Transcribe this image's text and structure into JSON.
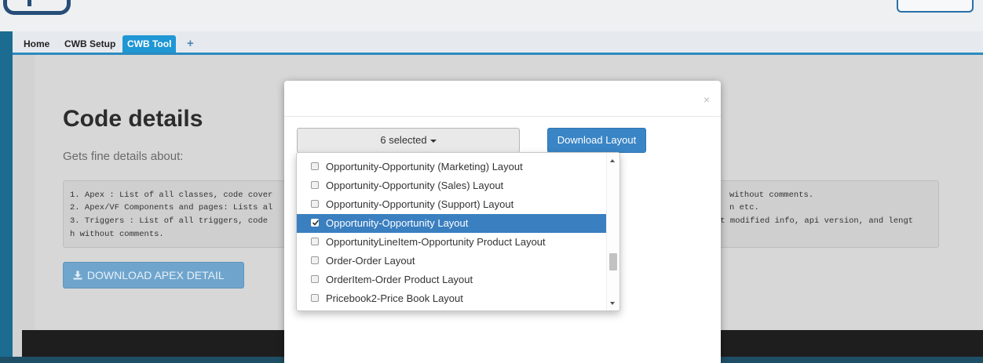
{
  "tabs": [
    {
      "label": "Home"
    },
    {
      "label": "CWB Setup"
    },
    {
      "label": "CWB Tool"
    }
  ],
  "tab_add_label": "+",
  "page": {
    "title": "Code details",
    "subtitle": "Gets fine details about:",
    "code_lines": [
      "1. Apex : List of all classes, code cover",
      "2. Apex/VF Components and pages: Lists al",
      "3. Triggers : List of all triggers, code",
      "h without comments."
    ],
    "code_tails": [
      "without comments.",
      "n etc.",
      "st modified info, api version, and lengt"
    ],
    "download_apex_label": "DOWNLOAD APEX DETAIL"
  },
  "modal": {
    "close_label": "×",
    "multiselect_label": "6 selected",
    "download_layout_label": "Download Layout",
    "options": [
      {
        "label": "Opportunity-Opportunity (Marketing) Layout",
        "checked": false
      },
      {
        "label": "Opportunity-Opportunity (Sales) Layout",
        "checked": false
      },
      {
        "label": "Opportunity-Opportunity (Support) Layout",
        "checked": false
      },
      {
        "label": "Opportunity-Opportunity Layout",
        "checked": true
      },
      {
        "label": "OpportunityLineItem-Opportunity Product Layout",
        "checked": false
      },
      {
        "label": "Order-Order Layout",
        "checked": false
      },
      {
        "label": "OrderItem-Order Product Layout",
        "checked": false
      },
      {
        "label": "Pricebook2-Price Book Layout",
        "checked": false
      }
    ]
  },
  "colors": {
    "accent": "#3a7fc0",
    "tab_active": "#1f97d4",
    "apex_button": "#6fa5cd"
  }
}
